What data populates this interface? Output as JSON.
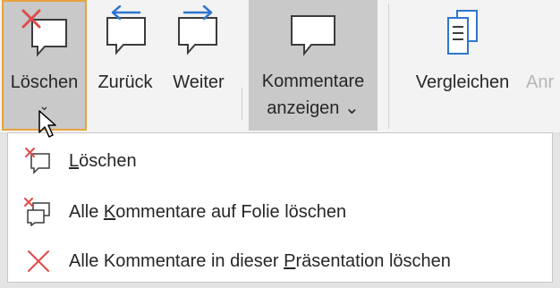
{
  "ribbon": {
    "delete_btn": {
      "label": "Löschen",
      "chevron": "⌄",
      "icon": "comment-delete-icon"
    },
    "prev_btn": {
      "label": "Zurück",
      "icon": "comment-previous-icon"
    },
    "next_btn": {
      "label": "Weiter",
      "icon": "comment-next-icon"
    },
    "show_btn": {
      "label_line1": "Kommentare",
      "label_line2": "anzeigen ⌄",
      "icon": "comment-icon"
    },
    "compare_btn": {
      "label": "Vergleichen",
      "icon": "compare-document-icon"
    },
    "cut_btn": {
      "label": "Anr",
      "disabled": true
    }
  },
  "menu": {
    "items": [
      {
        "pre": "",
        "ul": "L",
        "post": "öschen",
        "icon": "comment-delete-icon"
      },
      {
        "pre": "Alle ",
        "ul": "K",
        "post": "ommentare auf Folie löschen",
        "icon": "delete-slide-comments-icon"
      },
      {
        "pre": "Alle Kommentare in dieser ",
        "ul": "P",
        "post": "räsentation löschen",
        "icon": "close-x-icon"
      }
    ]
  },
  "colors": {
    "accent_blue": "#2e75d0",
    "delete_red": "#e04a4a",
    "highlight_border": "#e8a33d",
    "pressed_bg": "#c9c9c9"
  }
}
